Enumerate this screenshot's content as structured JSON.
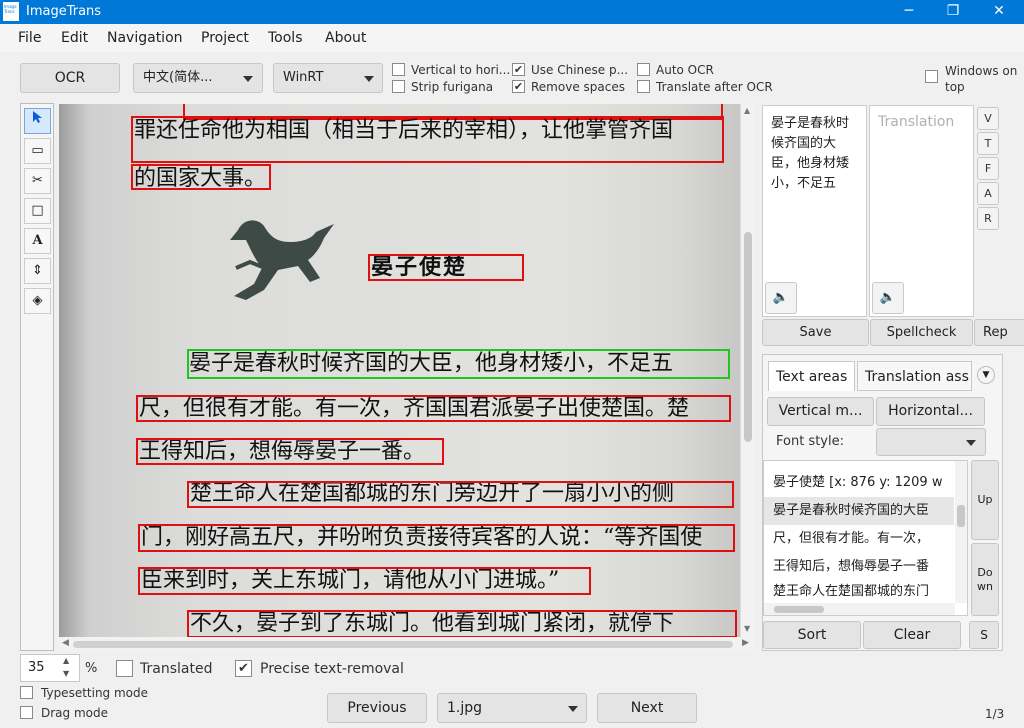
{
  "window": {
    "title": "ImageTrans",
    "icon_text": "Image Trans",
    "minimize": "─",
    "maximize": "❐",
    "close": "✕"
  },
  "menu": [
    "File",
    "Edit",
    "Navigation",
    "Project",
    "Tools",
    "About"
  ],
  "toolbar": {
    "ocr_label": "OCR",
    "language_value": "中文(简体...",
    "engine_value": "WinRT",
    "vertical_to_horizontal": {
      "label": "Vertical to hori...",
      "checked": false
    },
    "strip_furigana": {
      "label": "Strip furigana",
      "checked": false
    },
    "use_chinese": {
      "label": "Use Chinese p...",
      "checked": true
    },
    "remove_spaces": {
      "label": "Remove spaces",
      "checked": true
    },
    "auto_ocr": {
      "label": "Auto OCR",
      "checked": false
    },
    "translate_after_ocr": {
      "label": "Translate after OCR",
      "checked": false
    },
    "windows_on_top": {
      "label": "Windows on top",
      "checked": false
    }
  },
  "tools": [
    "pointer-icon",
    "region-icon",
    "scissors-icon",
    "rectangle-icon",
    "text-tool-icon",
    "move-updown-icon",
    "layers-icon"
  ],
  "canvas": {
    "lines": [
      "罪还任命他为相国（相当于后来的宰相），让他掌管齐国",
      "的国家大事。",
      "晏子使楚",
      "晏子是春秋时候齐国的大臣，他身材矮小，不足五",
      "尺，但很有才能。有一次，齐国国君派晏子出使楚国。楚",
      "王得知后，想侮辱晏子一番。",
      "楚王命人在楚国都城的东门旁边开了一扇小小的侧",
      "门，刚好高五尺，并吩咐负责接待宾客的人说：“等齐国使",
      "臣来到时，关上东城门，请他从小门进城。”",
      "不久，晏子到了东城门。他看到城门紧闭，就停下"
    ]
  },
  "source_text": "晏子是春秋时候齐国的大臣，他身材矮小，不足五",
  "translation_placeholder": "Translation",
  "side_letters": [
    "V",
    "T",
    "F",
    "A",
    "R"
  ],
  "buttons": {
    "save": "Save",
    "spellcheck": "Spellcheck",
    "replace": "Rep",
    "sort": "Sort",
    "clear": "Clear",
    "s": "S",
    "up": "Up",
    "down": "Do\nwn"
  },
  "tabs": {
    "text_areas": "Text areas",
    "translation_assist": "Translation ass"
  },
  "format": {
    "vertical": "Vertical m...",
    "horizontal": "Horizontal...",
    "font_style_label": "Font style:"
  },
  "text_areas": [
    "晏子使楚 [x: 876 y: 1209 w",
    "晏子是春秋时候齐国的大臣",
    "尺，但很有才能。有一次，",
    "王得知后，想侮辱晏子一番",
    "楚王命人在楚国都城的东门"
  ],
  "bottom": {
    "zoom_value": "35",
    "zoom_unit": "%",
    "translated": {
      "label": "Translated",
      "checked": false
    },
    "precise_removal": {
      "label": "Precise text-removal",
      "checked": true
    },
    "typesetting_mode": {
      "label": "Typesetting mode",
      "checked": false
    },
    "drag_mode": {
      "label": "Drag mode",
      "checked": false
    },
    "previous": "Previous",
    "next": "Next",
    "file": "1.jpg",
    "page": "1/3"
  },
  "colors": {
    "titlebar": "#0078d7",
    "box_red": "#e01010",
    "box_green": "#21c521"
  }
}
